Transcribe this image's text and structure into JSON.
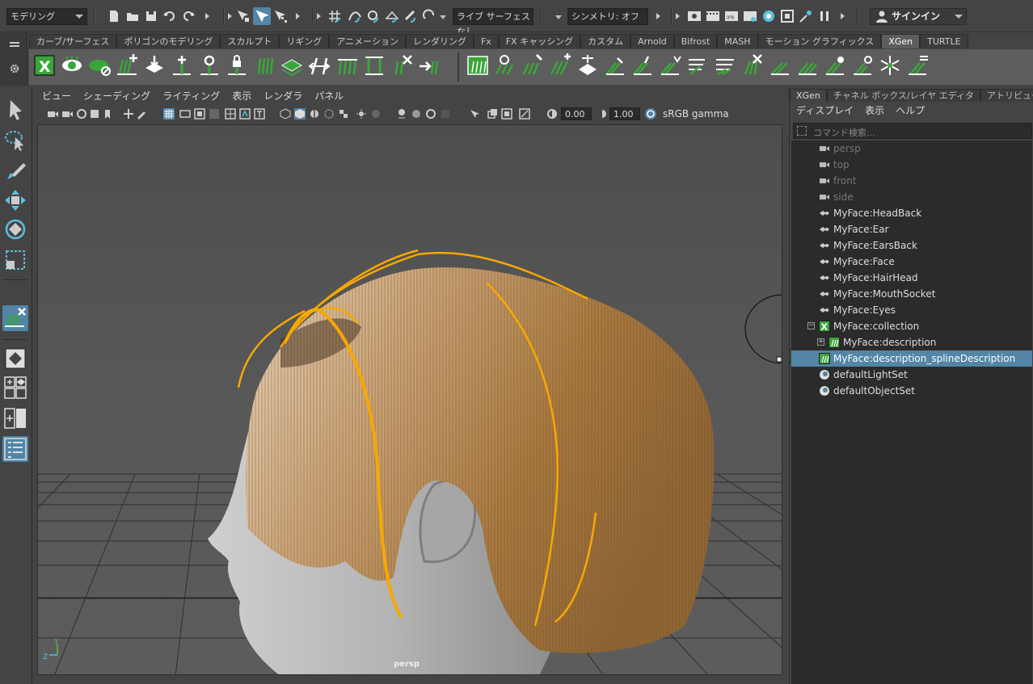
{
  "statusline": {
    "mode_menu": "モデリング",
    "live_surface": "ライブ サーフェスなし",
    "symmetry": "シンメトリ: オフ",
    "signin": "サインイン"
  },
  "shelf": {
    "tabs": [
      "カーブ/サーフェス",
      "ポリゴンのモデリング",
      "スカルプト",
      "リギング",
      "アニメーション",
      "レンダリング",
      "Fx",
      "FX キャッシング",
      "カスタム",
      "Arnold",
      "Bifrost",
      "MASH",
      "モーション グラフィックス",
      "XGen",
      "TURTLE"
    ],
    "active_tab": "XGen"
  },
  "viewport": {
    "menu": [
      "ビュー",
      "シェーディング",
      "ライティング",
      "表示",
      "レンダラ",
      "パネル"
    ],
    "exposure": "0.00",
    "gamma": "1.00",
    "color_space": "sRGB gamma",
    "camera_label": "persp",
    "axis_labels": {
      "y": "Y",
      "z": "Z"
    }
  },
  "outliner": {
    "tabs": [
      "XGen",
      "チャネル ボックス/レイヤ エディタ",
      "アトリビュート エ"
    ],
    "menu": [
      "ディスプレイ",
      "表示",
      "ヘルプ"
    ],
    "search_placeholder": "コマンド検索...",
    "items": [
      {
        "label": "persp",
        "type": "camera",
        "dim": true
      },
      {
        "label": "top",
        "type": "camera",
        "dim": true
      },
      {
        "label": "front",
        "type": "camera",
        "dim": true
      },
      {
        "label": "side",
        "type": "camera",
        "dim": true
      },
      {
        "label": "MyFace:HeadBack",
        "type": "set"
      },
      {
        "label": "MyFace:Ear",
        "type": "set"
      },
      {
        "label": "MyFace:EarsBack",
        "type": "set"
      },
      {
        "label": "MyFace:Face",
        "type": "set"
      },
      {
        "label": "MyFace:HairHead",
        "type": "set"
      },
      {
        "label": "MyFace:MouthSocket",
        "type": "set"
      },
      {
        "label": "MyFace:Eyes",
        "type": "set"
      },
      {
        "label": "MyFace:collection",
        "type": "xgen-collection"
      },
      {
        "label": "MyFace:description",
        "type": "xgen-description"
      },
      {
        "label": "MyFace:description_splineDescription",
        "type": "xgen-spline",
        "selected": true
      },
      {
        "label": "defaultLightSet",
        "type": "objset"
      },
      {
        "label": "defaultObjectSet",
        "type": "objset"
      }
    ]
  },
  "colors": {
    "accent": "#5285a6",
    "hair": "#a87c4e",
    "guide_curves": "#f7a800",
    "xgen_green": "#3aa63a"
  }
}
